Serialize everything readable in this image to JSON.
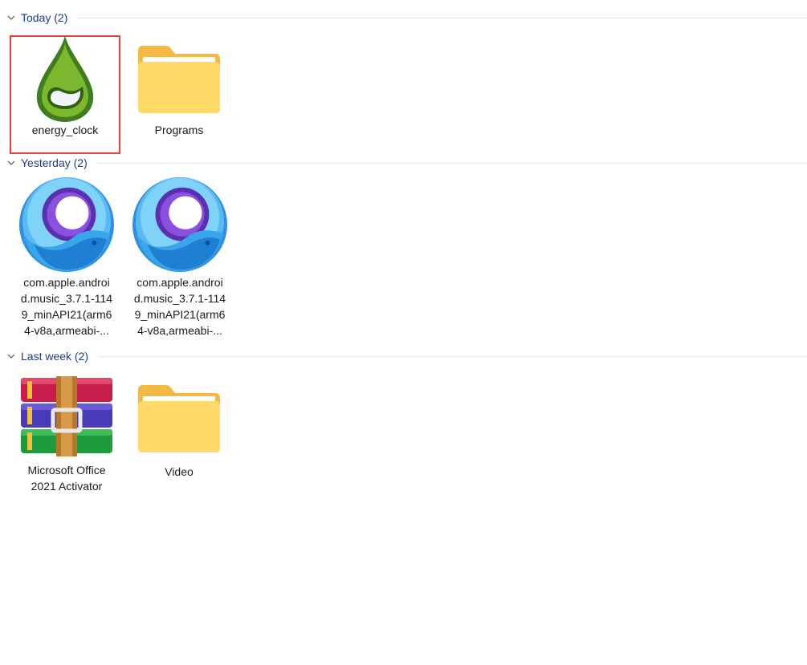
{
  "groups": [
    {
      "title": "Today (2)",
      "items": [
        {
          "label": "energy_clock",
          "icon": "energy-clock-drop-icon",
          "selected": true
        },
        {
          "label": "Programs",
          "icon": "folder-icon"
        }
      ]
    },
    {
      "title": "Yesterday (2)",
      "items": [
        {
          "label_lines": [
            "com.apple.androi",
            "d.music_3.7.1-114",
            "9_minAPI21(arm6",
            "4-v8a,armeabi-..."
          ],
          "icon": "gameloop-app-icon"
        },
        {
          "label_lines": [
            "com.apple.androi",
            "d.music_3.7.1-114",
            "9_minAPI21(arm6",
            "4-v8a,armeabi-..."
          ],
          "icon": "gameloop-app-icon"
        }
      ]
    },
    {
      "title": "Last week (2)",
      "items": [
        {
          "label_lines": [
            "Microsoft Office",
            "2021 Activator"
          ],
          "icon": "winrar-archive-icon"
        },
        {
          "label": "Video",
          "icon": "folder-icon"
        }
      ]
    }
  ],
  "colors": {
    "group_title": "#1f3a8a",
    "selection_border": "#e0473f",
    "folder_back": "#f4b942",
    "folder_front": "#ffd96a"
  }
}
